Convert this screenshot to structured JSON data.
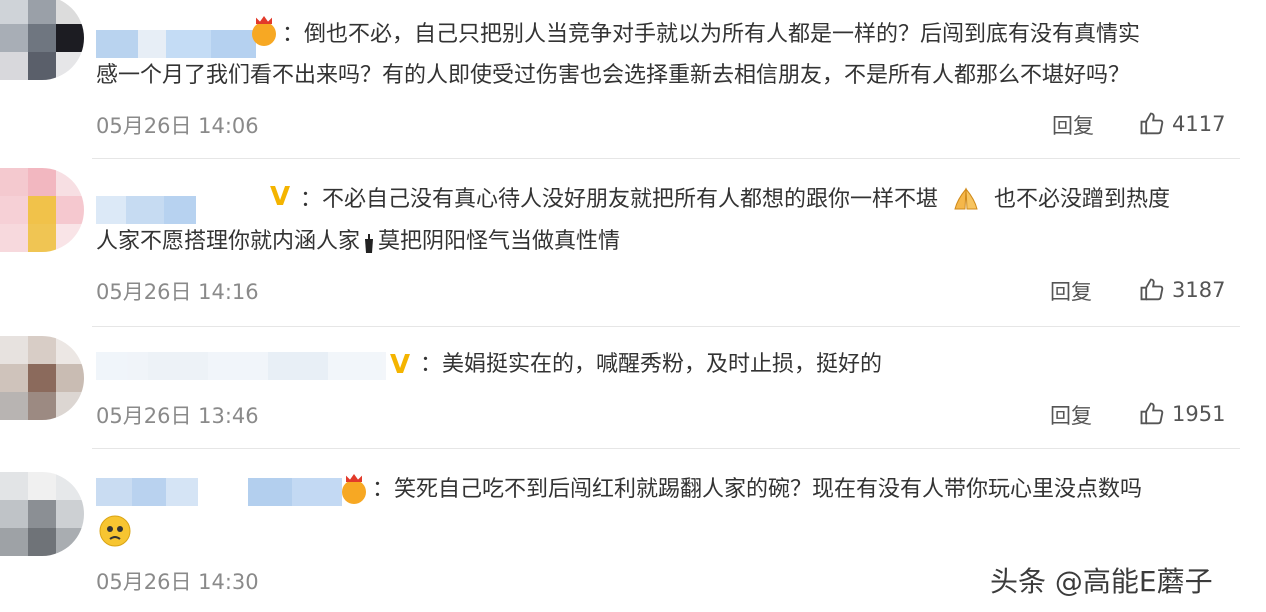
{
  "comments": [
    {
      "text_line1": "：倒也不必，自己只把别人当竞争对手就以为所有人都是一样的？后闯到底有没有真情实",
      "text_line2": "感一个月了我们看不出来吗？有的人即使受过伤害也会选择重新去相信朋友，不是所有人都那么不堪好吗？",
      "time": "05月26日 14:06",
      "reply_label": "回复",
      "likes": "4117",
      "badge_icon": "crown-emoji-icon"
    },
    {
      "text_line1a": "：不必自己没有真心待人没好朋友就把所有人都想的跟你一样不堪",
      "text_line1b": "也不必没蹭到热度",
      "text_line2a": "人家不愿搭理你就内涵人家",
      "text_line2b": "莫把阴阳怪气当做真性情",
      "time": "05月26日 14:16",
      "reply_label": "回复",
      "likes": "3187",
      "badge_icon": "verified-v-icon"
    },
    {
      "text_line1": "：美娟挺实在的，喊醒秀粉，及时止损，挺好的",
      "time": "05月26日 13:46",
      "reply_label": "回复",
      "likes": "1951",
      "badge_icon": "verified-v-icon"
    },
    {
      "text_line1": "：笑死自己吃不到后闯红利就踢翻人家的碗？现在有没有人带你玩心里没点数吗",
      "time": "05月26日 14:30",
      "badge_icon": "crown-emoji-icon"
    }
  ],
  "watermark": "头条 @高能E蘑子",
  "colors": {
    "text": "#333333",
    "time": "#8a8a8a",
    "verified": "#f4b400"
  }
}
